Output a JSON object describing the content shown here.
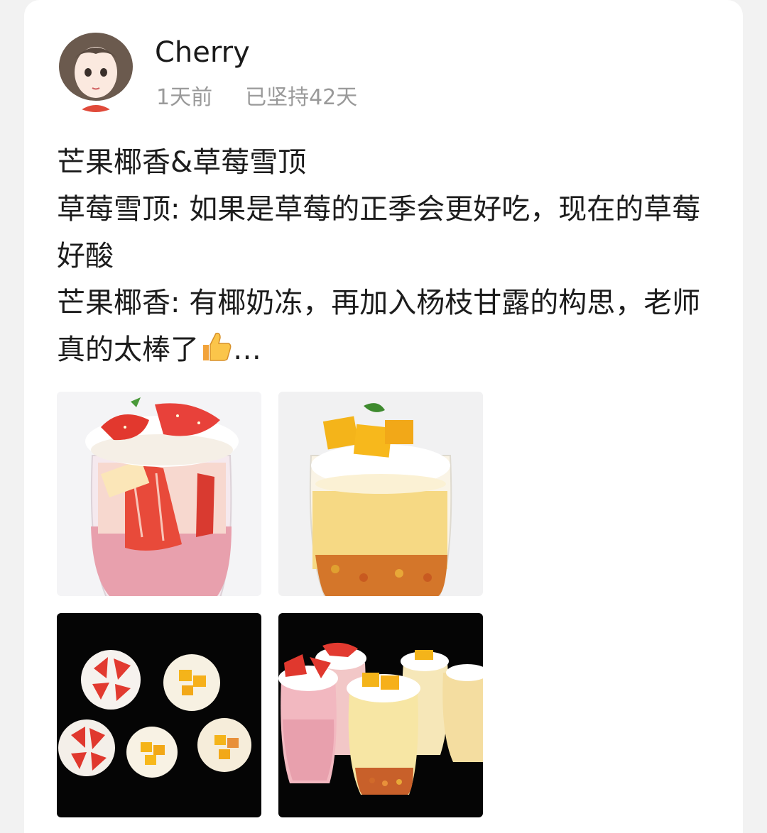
{
  "user": {
    "name": "Cherry",
    "time_ago": "1天前",
    "streak": "已坚持42天",
    "avatar_icon": "cartoon-girl-avatar"
  },
  "post": {
    "lines": [
      "芒果椰香&草莓雪顶",
      "草莓雪顶: 如果是草莓的正季会更好吃，现在的草莓好酸",
      "芒果椰香: 有椰奶冻，再加入杨枝甘露的构思，老师真的太棒了"
    ],
    "ending_emoji": "thumbs-up-icon",
    "ellipsis": "…"
  },
  "photos": [
    {
      "name": "strawberry-dessert-cup-photo"
    },
    {
      "name": "mango-coconut-dessert-cup-photo"
    },
    {
      "name": "desserts-top-view-photo"
    },
    {
      "name": "desserts-group-photo"
    }
  ],
  "colors": {
    "strawberry": "#e03a3a",
    "mango": "#f4b41a",
    "cream": "#ffffff",
    "meta_gray": "#9a9a9a"
  }
}
